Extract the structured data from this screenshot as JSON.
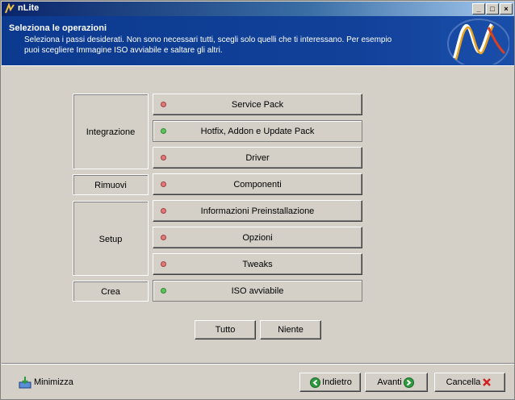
{
  "window": {
    "title": "nLite",
    "controls": {
      "minimize": "_",
      "maximize": "□",
      "close": "×"
    }
  },
  "header": {
    "title": "Seleziona le operazioni",
    "description": "Seleziona i passi desiderati. Non sono necessari tutti, scegli solo quelli che ti interessano. Per esempio puoi scegliere Immagine ISO avviabile e saltare gli altri.",
    "logo": "nlite-logo"
  },
  "groups": {
    "integrazione": "Integrazione",
    "rimuovi": "Rimuovi",
    "setup": "Setup",
    "crea": "Crea"
  },
  "operations": [
    {
      "label": "Service Pack",
      "status": "off"
    },
    {
      "label": "Hotfix, Addon e Update Pack",
      "status": "on"
    },
    {
      "label": "Driver",
      "status": "off"
    },
    {
      "label": "Componenti",
      "status": "off"
    },
    {
      "label": "Informazioni Preinstallazione",
      "status": "off"
    },
    {
      "label": "Opzioni",
      "status": "off"
    },
    {
      "label": "Tweaks",
      "status": "off"
    },
    {
      "label": "ISO avviabile",
      "status": "on"
    }
  ],
  "selection": {
    "all": "Tutto",
    "none": "Niente"
  },
  "footer": {
    "minimize": "Minimizza",
    "back": "Indietro",
    "next": "Avanti",
    "cancel": "Cancella"
  },
  "colors": {
    "status_on": "#5cc45c",
    "status_off": "#e07a7a",
    "header_bg": "#0e3b8a",
    "face": "#d4d0c8"
  }
}
